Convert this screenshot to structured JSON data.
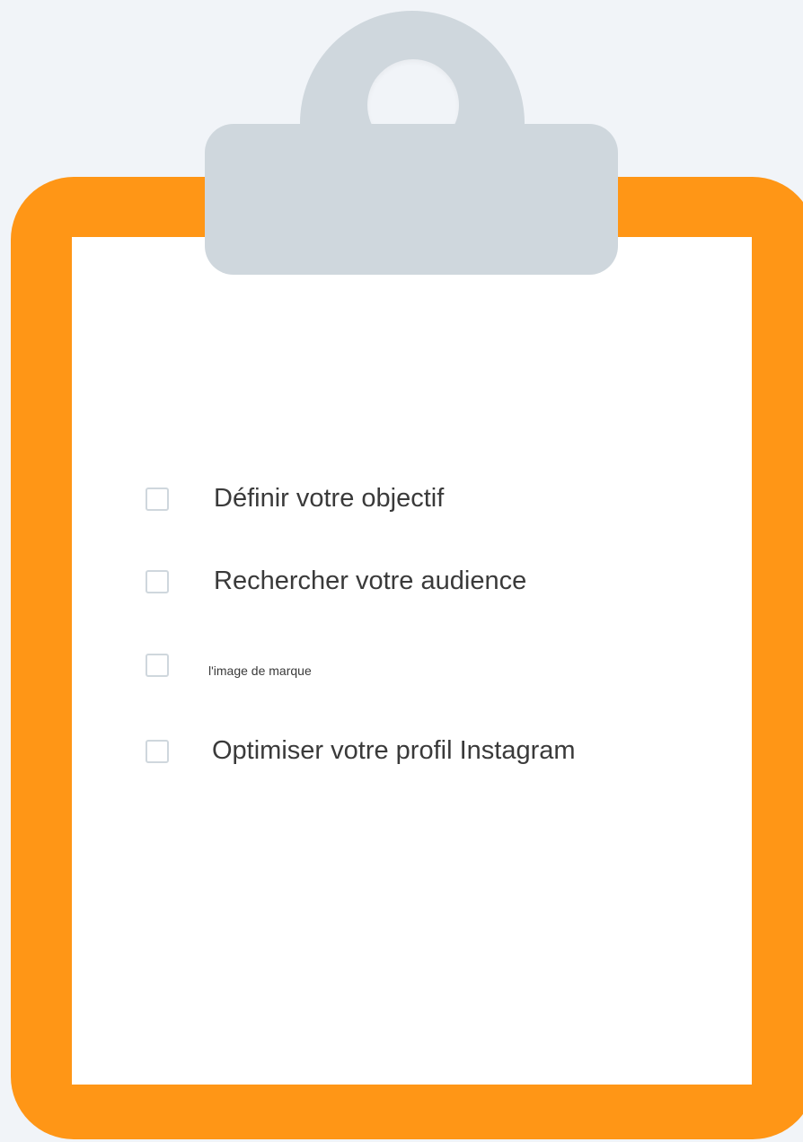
{
  "colors": {
    "background": "#f1f4f8",
    "board": "#ff9616",
    "paper": "#ffffff",
    "clip": "#cfd7dd",
    "checkbox_border": "#cfd7dd",
    "text": "#3a3a3a"
  },
  "checklist": {
    "items": [
      {
        "label": "Définir votre objectif",
        "checked": false
      },
      {
        "label": "Rechercher votre audience",
        "checked": false
      },
      {
        "label": "l'image de marque",
        "checked": false
      },
      {
        "label": "Optimiser votre profil Instagram",
        "checked": false
      }
    ]
  }
}
